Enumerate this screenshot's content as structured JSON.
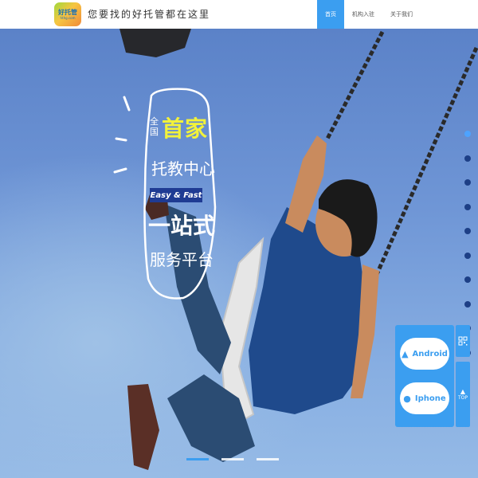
{
  "header": {
    "logo_text": "好托管",
    "logo_sub": "hthg.com",
    "slogan": "您要找的好托管都在这里",
    "nav": [
      {
        "label": "首页",
        "active": true
      },
      {
        "label": "机构入驻",
        "active": false
      },
      {
        "label": "关于我们",
        "active": false
      }
    ]
  },
  "hero": {
    "line1_small": "全国",
    "line1_big": "首家",
    "line2": "托教中心",
    "badge": "Easy & Fast",
    "line3": "一站式",
    "line4": "服务平台"
  },
  "slider": {
    "dot_count": 10,
    "active_dot": 0,
    "bars": 3,
    "active_bar": 0
  },
  "download": {
    "android_label": "Android",
    "iphone_label": "Iphone",
    "top_label": "TOP"
  },
  "colors": {
    "accent": "#3b9ef0",
    "highlight_yellow": "#f2f23a",
    "badge_navy": "#1f3b93",
    "dot_navy": "#1d3f86"
  }
}
